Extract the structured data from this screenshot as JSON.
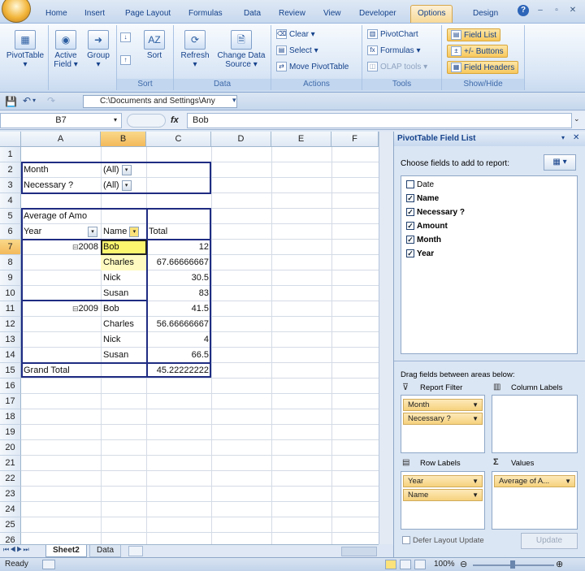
{
  "tabs": [
    "Home",
    "Insert",
    "Page Layout",
    "Formulas",
    "Data",
    "Review",
    "View",
    "Developer",
    "Options",
    "Design"
  ],
  "ribbon": {
    "groups": {
      "sort": "Sort",
      "data": "Data",
      "actions": "Actions",
      "tools": "Tools",
      "showhide": "Show/Hide"
    },
    "pivottable": "PivotTable",
    "active_field_1": "Active",
    "active_field_2": "Field",
    "group": "Group",
    "sort": "Sort",
    "refresh": "Refresh",
    "change_source_1": "Change Data",
    "change_source_2": "Source",
    "clear": "Clear",
    "select": "Select",
    "move": "Move PivotTable",
    "pivotchart": "PivotChart",
    "formulas": "Formulas",
    "olap": "OLAP tools",
    "field_list": "Field List",
    "buttons": "+/- Buttons",
    "field_headers": "Field Headers"
  },
  "qat": {
    "path": "C:\\Documents and Settings\\Any"
  },
  "formula_bar": {
    "name_box": "B7",
    "fx": "fx",
    "content": "Bob"
  },
  "columns": [
    "A",
    "B",
    "C",
    "D",
    "E",
    "F"
  ],
  "rows": [
    "1",
    "2",
    "3",
    "4",
    "5",
    "6",
    "7",
    "8",
    "9",
    "10",
    "11",
    "12",
    "13",
    "14",
    "15",
    "16",
    "17",
    "18",
    "19",
    "20",
    "21",
    "22",
    "23",
    "24",
    "25",
    "26"
  ],
  "cells": {
    "a2": "Month",
    "b2": "(All)",
    "a3": "Necessary ?",
    "b3": "(All)",
    "a5": "Average of Amo",
    "a6": "Year",
    "b6": "Name",
    "c6": "Total",
    "a7": "2008",
    "b7": "Bob",
    "c7": "12",
    "b8": "Charles",
    "c8": "67.66666667",
    "b9": "Nick",
    "c9": "30.5",
    "b10": "Susan",
    "c10": "83",
    "a11": "2009",
    "b11": "Bob",
    "c11": "41.5",
    "b12": "Charles",
    "c12": "56.66666667",
    "b13": "Nick",
    "c13": "4",
    "b14": "Susan",
    "c14": "66.5",
    "a15": "Grand Total",
    "c15": "45.22222222"
  },
  "sheet_tabs": [
    "Sheet2",
    "Data"
  ],
  "status": {
    "ready": "Ready",
    "zoom": "100%"
  },
  "panel": {
    "title": "PivotTable Field List",
    "choose": "Choose fields to add to report:",
    "fields": [
      {
        "name": "Date",
        "checked": false
      },
      {
        "name": "Name",
        "checked": true
      },
      {
        "name": "Necessary ?",
        "checked": true
      },
      {
        "name": "Amount",
        "checked": true
      },
      {
        "name": "Month",
        "checked": true
      },
      {
        "name": "Year",
        "checked": true
      }
    ],
    "drag": "Drag fields between areas below:",
    "report_filter": "Report Filter",
    "column_labels": "Column Labels",
    "row_labels": "Row Labels",
    "values": "Values",
    "filter_items": [
      "Month",
      "Necessary ?"
    ],
    "row_items": [
      "Year",
      "Name"
    ],
    "value_items": [
      "Average of A..."
    ],
    "defer": "Defer Layout Update",
    "update": "Update"
  }
}
